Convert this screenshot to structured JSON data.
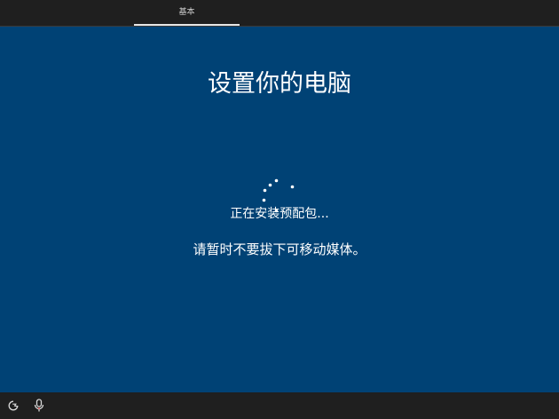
{
  "topbar": {
    "tabs": [
      {
        "label": "基本",
        "active": true
      }
    ]
  },
  "main": {
    "title": "设置你的电脑",
    "status": "正在安装预配包...",
    "hint": "请暂时不要拔下可移动媒体。"
  },
  "bottombar": {
    "icons": [
      "accessibility-icon",
      "microphone-icon"
    ]
  },
  "colors": {
    "background": "#004275",
    "bar": "#1f1f1f",
    "text": "#ffffff"
  }
}
